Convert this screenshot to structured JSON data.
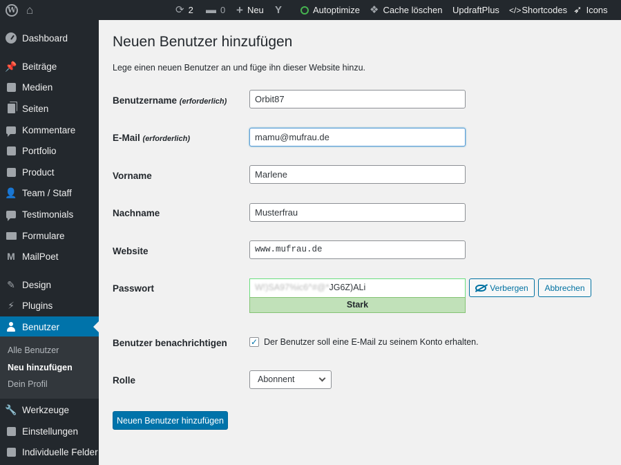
{
  "adminbar": {
    "updates_count": "2",
    "comments_count": "0",
    "new_label": "Neu",
    "autoptimize_label": "Autoptimize",
    "cache_label": "Cache löschen",
    "updraft_label": "UpdraftPlus",
    "shortcodes_label": "Shortcodes",
    "icons_label": "Icons"
  },
  "sidebar": {
    "items": [
      {
        "label": "Dashboard",
        "icon": "dashboard-icon"
      },
      {
        "label": "Beiträge",
        "icon": "pin-icon"
      },
      {
        "label": "Medien",
        "icon": "media-icon"
      },
      {
        "label": "Seiten",
        "icon": "pages-icon"
      },
      {
        "label": "Kommentare",
        "icon": "comment-icon"
      },
      {
        "label": "Portfolio",
        "icon": "portfolio-icon"
      },
      {
        "label": "Product",
        "icon": "product-icon"
      },
      {
        "label": "Team / Staff",
        "icon": "team-icon"
      },
      {
        "label": "Testimonials",
        "icon": "testimonial-icon"
      },
      {
        "label": "Formulare",
        "icon": "envelope-icon"
      },
      {
        "label": "MailPoet",
        "icon": "mailpoet-icon"
      },
      {
        "label": "Design",
        "icon": "brush-icon"
      },
      {
        "label": "Plugins",
        "icon": "plugin-icon"
      },
      {
        "label": "Benutzer",
        "icon": "user-icon"
      },
      {
        "label": "Werkzeuge",
        "icon": "wrench-icon"
      },
      {
        "label": "Einstellungen",
        "icon": "settings-icon"
      },
      {
        "label": "Individuelle Felder",
        "icon": "fields-icon"
      }
    ],
    "submenu": [
      {
        "label": "Alle Benutzer"
      },
      {
        "label": "Neu hinzufügen"
      },
      {
        "label": "Dein Profil"
      }
    ]
  },
  "page": {
    "title": "Neuen Benutzer hinzufügen",
    "intro": "Lege einen neuen Benutzer an und füge ihn dieser Website hinzu.",
    "required_note": "(erforderlich)",
    "fields": {
      "username": {
        "label": "Benutzername",
        "value": "Orbit87"
      },
      "email": {
        "label": "E-Mail",
        "value": "mamu@mufrau.de"
      },
      "firstname": {
        "label": "Vorname",
        "value": "Marlene"
      },
      "lastname": {
        "label": "Nachname",
        "value": "Musterfrau"
      },
      "website": {
        "label": "Website",
        "value": "www.mufrau.de"
      },
      "password": {
        "label": "Passwort",
        "value_hidden": "W!)SA97%ic6^#@*",
        "value_visible": "JG6Z)ALi",
        "strength": "Stark",
        "hide_label": "Verbergen",
        "cancel_label": "Abbrechen"
      },
      "notify": {
        "label": "Benutzer benachrichtigen",
        "checkbox_label": "Der Benutzer soll eine E-Mail zu seinem Konto erhalten.",
        "checked": true
      },
      "role": {
        "label": "Rolle",
        "value": "Abonnent"
      }
    },
    "submit_label": "Neuen Benutzer hinzufügen"
  },
  "colors": {
    "accent": "#0073aa",
    "adminbar": "#23282d",
    "strength_bg": "#c1e1b9"
  }
}
